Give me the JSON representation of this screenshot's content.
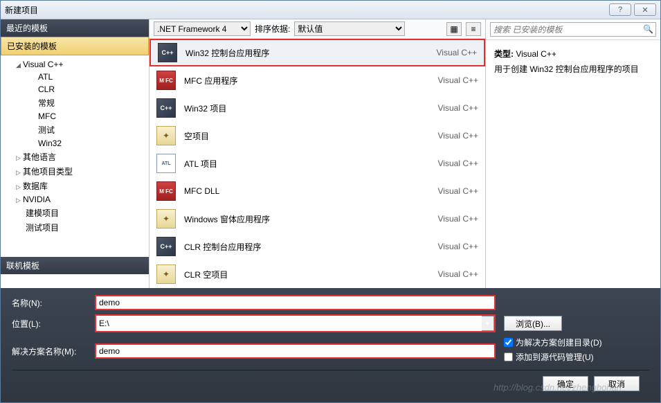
{
  "window": {
    "title": "新建项目"
  },
  "sidebar": {
    "recent": "最近的模板",
    "installed": "已安装的模板",
    "online": "联机模板",
    "tree": [
      {
        "label": "Visual C++",
        "expanded": true,
        "level": 1,
        "children": [
          {
            "label": "ATL"
          },
          {
            "label": "CLR"
          },
          {
            "label": "常规"
          },
          {
            "label": "MFC"
          },
          {
            "label": "测试"
          },
          {
            "label": "Win32"
          }
        ]
      },
      {
        "label": "其他语言",
        "expanded": false,
        "level": 1
      },
      {
        "label": "其他项目类型",
        "expanded": false,
        "level": 1
      },
      {
        "label": "数据库",
        "expanded": false,
        "level": 1
      },
      {
        "label": "NVIDIA",
        "expanded": false,
        "level": 1
      },
      {
        "label": "建模项目",
        "expanded": false,
        "level": 1
      },
      {
        "label": "测试项目",
        "expanded": false,
        "level": 1
      }
    ]
  },
  "toolbar": {
    "framework": ".NET Framework 4",
    "sortLabel": "排序依据:",
    "sortValue": "默认值"
  },
  "templates": [
    {
      "name": "Win32 控制台应用程序",
      "lang": "Visual C++",
      "icon": "vs",
      "selected": true
    },
    {
      "name": "MFC 应用程序",
      "lang": "Visual C++",
      "icon": "mfc"
    },
    {
      "name": "Win32 项目",
      "lang": "Visual C++",
      "icon": "vs"
    },
    {
      "name": "空项目",
      "lang": "Visual C++",
      "icon": "empty"
    },
    {
      "name": "ATL 项目",
      "lang": "Visual C++",
      "icon": "atl"
    },
    {
      "name": "MFC DLL",
      "lang": "Visual C++",
      "icon": "mfc"
    },
    {
      "name": "Windows 窗体应用程序",
      "lang": "Visual C++",
      "icon": "empty"
    },
    {
      "name": "CLR 控制台应用程序",
      "lang": "Visual C++",
      "icon": "vs"
    },
    {
      "name": "CLR 空项目",
      "lang": "Visual C++",
      "icon": "empty"
    }
  ],
  "search": {
    "placeholder": "搜索 已安装的模板"
  },
  "details": {
    "typeLabel": "类型:",
    "typeValue": "Visual C++",
    "description": "用于创建 Win32 控制台应用程序的项目"
  },
  "form": {
    "nameLabel": "名称(N):",
    "nameValue": "demo",
    "locationLabel": "位置(L):",
    "locationValue": "E:\\",
    "solutionLabel": "解决方案名称(M):",
    "solutionValue": "demo",
    "browse": "浏览(B)...",
    "createDir": "为解决方案创建目录(D)",
    "addSource": "添加到源代码管理(U)"
  },
  "buttons": {
    "ok": "确定",
    "cancel": "取消"
  },
  "watermark": "http://blog.csdn.net/zhengbohan"
}
